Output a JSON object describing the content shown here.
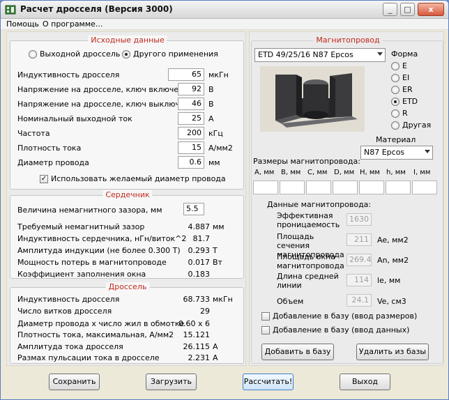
{
  "window": {
    "title": "Расчет дросселя (Версия 3000)",
    "minimize": "_",
    "maximize": "□",
    "close": "x"
  },
  "menu": {
    "help": "Помощь",
    "about": "О программе..."
  },
  "input": {
    "title": "Исходные данные",
    "mode_output": "Выходной дроссель",
    "mode_other": "Другого применения",
    "rows": [
      {
        "label": "Индуктивность  дросселя",
        "value": "65",
        "unit": "мкГн"
      },
      {
        "label": "Напряжение на дросселе, ключ включен",
        "value": "92",
        "unit": "В"
      },
      {
        "label": "Напряжение на дросселе, ключ выключен",
        "value": "46",
        "unit": "В"
      },
      {
        "label": "Номинальный выходной ток",
        "value": "25",
        "unit": "А"
      },
      {
        "label": "Частота",
        "value": "200",
        "unit": "кГц"
      },
      {
        "label": "Плотность тока",
        "value": "15",
        "unit": "А/мм2"
      },
      {
        "label": "Диаметр провода",
        "value": "0.6",
        "unit": "мм"
      }
    ],
    "use_diameter": "Использовать желаемый диаметр провода",
    "use_diameter_mark": "✓"
  },
  "core": {
    "title": "Сердечник",
    "gap_label": "Величина немагнитного зазора, мм",
    "gap_value": "5.5",
    "rows": [
      {
        "label": "Требуемый немагнитный зазор",
        "value": "4.887",
        "unit": "мм"
      },
      {
        "label": "Индуктивность сердечника, нГн/виток^2",
        "value": "81.7",
        "unit": ""
      },
      {
        "label": "Амплитуда индукции   (не более 0.300 Т)",
        "value": "0.293",
        "unit": "Т"
      },
      {
        "label": "Мощность потерь в магнитопроводе",
        "value": "0.017",
        "unit": "Вт"
      },
      {
        "label": "Коэффициент заполнения окна",
        "value": "0.183",
        "unit": ""
      }
    ]
  },
  "choke": {
    "title": "Дроссель",
    "rows": [
      {
        "label": "Индуктивность дросселя",
        "value": "68.733",
        "unit": "мкГн"
      },
      {
        "label": "Число витков дросселя",
        "value": "29",
        "unit": ""
      },
      {
        "label": "Диаметр провода х число жил в обмотке",
        "value": "0.60 х 6",
        "unit": ""
      },
      {
        "label": "Плотность тока, максимальная, А/мм2",
        "value": "15.121",
        "unit": ""
      },
      {
        "label": "Амплитуда тока дросселя",
        "value": "26.115",
        "unit": "А"
      },
      {
        "label": "Размах пульсации тока в дросселе",
        "value": "2.231",
        "unit": "А"
      }
    ]
  },
  "magnet": {
    "title": "Магнитопровод",
    "core_select": "ETD 49/25/16 N87 Epcos",
    "shape_label": "Форма",
    "shapes": [
      "E",
      "EI",
      "ER",
      "ETD",
      "R",
      "Другая"
    ],
    "shape_selected": "ETD",
    "material_label": "Материал",
    "material_select": "N87 Epcos",
    "dims_label": "Размеры магнитопровода:",
    "dims_headers": [
      "A, мм",
      "B, мм",
      "C, мм",
      "D, мм",
      "H, мм",
      "h, мм",
      "I, мм"
    ],
    "data_label": "Данные магнитопровода:",
    "params": [
      {
        "label": "Эффективная проницаемость",
        "value": "1630",
        "unit": ""
      },
      {
        "label": "Площадь сечения магнитопровода",
        "value": "211",
        "unit": "Ae, мм2"
      },
      {
        "label": "Площадь окна магнитопровода",
        "value": "269.4",
        "unit": "An, мм2"
      },
      {
        "label": "Длина средней линии",
        "value": "114",
        "unit": "le, мм"
      },
      {
        "label": "Объем",
        "value": "24.1",
        "unit": "Ve, см3"
      }
    ],
    "add_sizes": "Добавление в базу (ввод размеров)",
    "add_data": "Добавление в базу (ввод данных)",
    "add_button": "Добавить в базу",
    "delete_button": "Удалить из базы"
  },
  "buttons": {
    "save": "Сохранить",
    "load": "Загрузить",
    "calc": "Рассчитать!",
    "exit": "Выход"
  },
  "colors": {
    "group_title": "#c0281c"
  }
}
